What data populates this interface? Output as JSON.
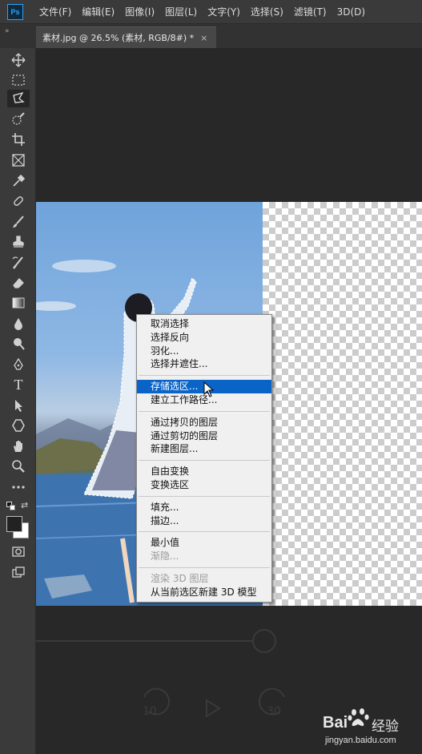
{
  "app": {
    "logo_text": "Ps"
  },
  "menu": [
    {
      "label": "文件(F)"
    },
    {
      "label": "编辑(E)"
    },
    {
      "label": "图像(I)"
    },
    {
      "label": "图层(L)"
    },
    {
      "label": "文字(Y)"
    },
    {
      "label": "选择(S)"
    },
    {
      "label": "滤镜(T)"
    },
    {
      "label": "3D(D)"
    }
  ],
  "panel_toggle": "»",
  "document_tab": {
    "title": "素材.jpg @ 26.5% (素材, RGB/8#) *",
    "close_label": "×"
  },
  "tools": [
    {
      "icon": "move-icon"
    },
    {
      "icon": "rect-marquee-icon"
    },
    {
      "icon": "lasso-icon",
      "active": true
    },
    {
      "icon": "quick-select-icon"
    },
    {
      "icon": "crop-icon"
    },
    {
      "icon": "frame-icon"
    },
    {
      "icon": "eyedropper-icon"
    },
    {
      "icon": "healing-brush-icon"
    },
    {
      "icon": "brush-icon"
    },
    {
      "icon": "stamp-icon"
    },
    {
      "icon": "history-brush-icon"
    },
    {
      "icon": "eraser-icon"
    },
    {
      "icon": "gradient-icon"
    },
    {
      "icon": "blur-icon"
    },
    {
      "icon": "dodge-icon"
    },
    {
      "icon": "pen-icon"
    },
    {
      "icon": "type-icon"
    },
    {
      "icon": "path-select-icon"
    },
    {
      "icon": "shape-icon"
    },
    {
      "icon": "hand-icon"
    },
    {
      "icon": "zoom-icon"
    },
    {
      "icon": "more-tools-icon"
    }
  ],
  "type_tool_glyph": "T",
  "colors": {
    "foreground": "#222222",
    "background": "#ffffff",
    "selection": "#0a64c8"
  },
  "context_menu": {
    "groups": [
      [
        {
          "label": "取消选择"
        },
        {
          "label": "选择反向"
        },
        {
          "label": "羽化..."
        },
        {
          "label": "选择并遮住..."
        }
      ],
      [
        {
          "label": "存储选区...",
          "selected": true
        },
        {
          "label": "建立工作路径..."
        }
      ],
      [
        {
          "label": "通过拷贝的图层"
        },
        {
          "label": "通过剪切的图层"
        },
        {
          "label": "新建图层..."
        }
      ],
      [
        {
          "label": "自由变换"
        },
        {
          "label": "变换选区"
        }
      ],
      [
        {
          "label": "填充..."
        },
        {
          "label": "描边..."
        }
      ],
      [
        {
          "label": "最小值"
        },
        {
          "label": "渐隐...",
          "disabled": true
        }
      ],
      [
        {
          "label": "渲染 3D 图层",
          "disabled": true
        },
        {
          "label": "从当前选区新建 3D 模型"
        }
      ]
    ]
  },
  "video_overlay": {
    "rewind": "10",
    "forward": "30"
  },
  "watermark": {
    "brand": "Bai",
    "brand_cn": "经验",
    "url": "jingyan.baidu.com"
  }
}
